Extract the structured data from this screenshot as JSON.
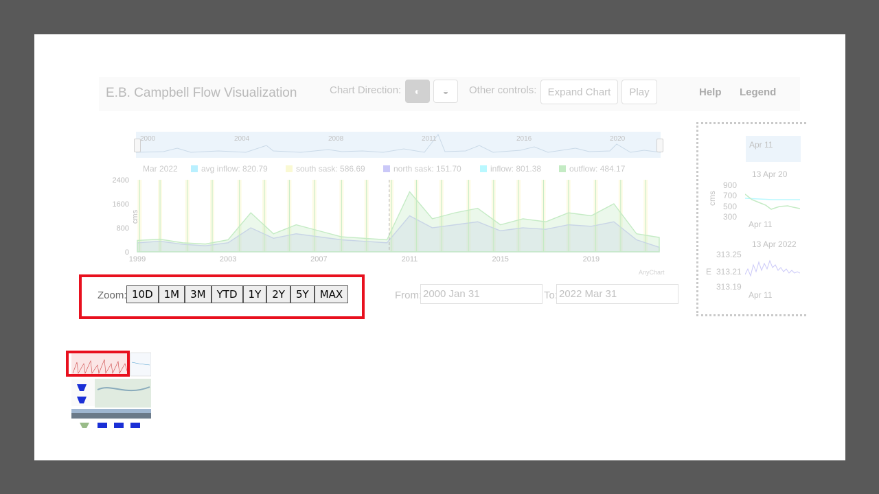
{
  "app": {
    "title": "E.B. Campbell Flow Visualization",
    "chart_direction_label": "Chart Direction:",
    "direction_icons": [
      "half-circle-vertical-icon",
      "half-circle-horizontal-icon"
    ],
    "other_controls_label": "Other controls:",
    "expand_chart_label": "Expand Chart",
    "play_label": "Play",
    "nav": {
      "help": "Help",
      "legend": "Legend"
    }
  },
  "scroller": {
    "years": [
      "2000",
      "2004",
      "2008",
      "2011",
      "2016",
      "2020"
    ]
  },
  "legend_bar": {
    "date": "Mar 2022",
    "items": [
      {
        "label": "avg inflow: 820.79",
        "color": "#66e0ff"
      },
      {
        "label": "south sask: 586.69",
        "color": "#f5f2a0"
      },
      {
        "label": "north sask: 151.70",
        "color": "#8c86f0"
      },
      {
        "label": "inflow: 801.38",
        "color": "#66f0ff"
      },
      {
        "label": "outflow: 484.17",
        "color": "#7ed37e"
      }
    ]
  },
  "chart_data": {
    "type": "area",
    "ylabel": "cms",
    "ylim": [
      0,
      2400
    ],
    "yticks": [
      "2400",
      "1600",
      "800",
      "0"
    ],
    "xticks": [
      "1999",
      "2003",
      "2007",
      "2011",
      "2015",
      "2019"
    ],
    "x": [
      1999,
      2000,
      2001,
      2002,
      2003,
      2004,
      2005,
      2006,
      2007,
      2008,
      2009,
      2010,
      2011,
      2012,
      2013,
      2014,
      2015,
      2016,
      2017,
      2018,
      2019,
      2020,
      2021,
      2022
    ],
    "series": [
      {
        "name": "outflow",
        "color": "#7ed37e",
        "values": [
          380,
          420,
          300,
          260,
          400,
          1300,
          600,
          900,
          700,
          500,
          450,
          400,
          2000,
          1100,
          1300,
          1450,
          900,
          1100,
          1000,
          1300,
          1200,
          1600,
          600,
          480
        ]
      },
      {
        "name": "north sask",
        "color": "#8c86f0",
        "values": [
          300,
          350,
          250,
          200,
          300,
          800,
          450,
          600,
          500,
          400,
          350,
          300,
          1200,
          800,
          900,
          1000,
          700,
          800,
          750,
          900,
          850,
          1000,
          400,
          150
        ]
      }
    ],
    "spikes": [
      1999.1,
      2000,
      2001.2,
      2002.3,
      2003.5,
      2004.6,
      2005.7,
      2006.8,
      2008,
      2009.1,
      2010.2,
      2011.3,
      2012.4,
      2013.6,
      2014.7,
      2015.8,
      2016.9,
      2018,
      2019.2,
      2020.3,
      2021.4
    ],
    "marker_x": 2010.1
  },
  "branding": "AnyChart",
  "zoom": {
    "label": "Zoom:",
    "buttons": [
      "10D",
      "1M",
      "3M",
      "YTD",
      "1Y",
      "2Y",
      "5Y",
      "MAX"
    ]
  },
  "range": {
    "from_label": "From:",
    "from_value": "2000 Jan 31",
    "to_label": "To:",
    "to_value": "2022 Mar 31"
  },
  "side_panel": {
    "scroll_label": "Apr 11",
    "chart1": {
      "title": "13 Apr 20",
      "ylabel": "cms",
      "yticks": [
        "900",
        "700",
        "500",
        "300"
      ],
      "xlabel": "Apr 11"
    },
    "chart2": {
      "title": "13 Apr 2022",
      "ylabel": "E",
      "yticks": [
        "313.25",
        "313.21",
        "313.19"
      ],
      "xlabel": "Apr 11"
    }
  },
  "highlight_color": "#e8101e"
}
